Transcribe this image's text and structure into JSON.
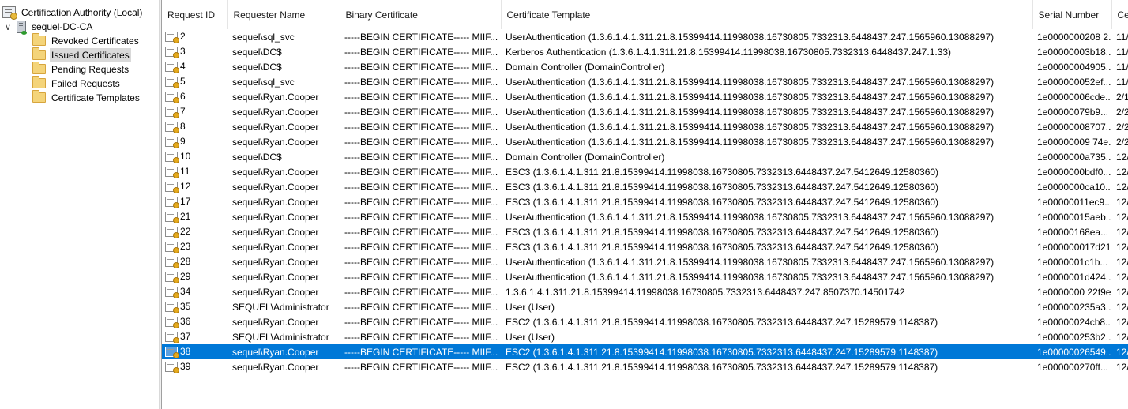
{
  "tree": {
    "root": "Certification Authority (Local)",
    "ca": "sequel-DC-CA",
    "children": [
      "Revoked Certificates",
      "Issued Certificates",
      "Pending Requests",
      "Failed Requests",
      "Certificate Templates"
    ],
    "selected_index": 1,
    "expand_glyph": "∨"
  },
  "table": {
    "headers": [
      "Request ID",
      "Requester Name",
      "Binary Certificate",
      "Certificate Template",
      "Serial Number",
      "Ce"
    ],
    "selected_row": 21,
    "rows": [
      [
        "2",
        "sequel\\sql_svc",
        "-----BEGIN CERTIFICATE-----  MIIF...",
        "UserAuthentication (1.3.6.1.4.1.311.21.8.15399414.11998038.16730805.7332313.6448437.247.1565960.13088297)",
        "1e0000000208 2...",
        "11/"
      ],
      [
        "3",
        "sequel\\DC$",
        "-----BEGIN CERTIFICATE-----  MIIF...",
        "Kerberos Authentication (1.3.6.1.4.1.311.21.8.15399414.11998038.16730805.7332313.6448437.247.1.33)",
        "1e00000003b18...",
        "11/"
      ],
      [
        "4",
        "sequel\\DC$",
        "-----BEGIN CERTIFICATE-----  MIIF...",
        "Domain Controller (DomainController)",
        "1e00000004905...",
        "11/"
      ],
      [
        "5",
        "sequel\\sql_svc",
        "-----BEGIN CERTIFICATE-----  MIIF...",
        "UserAuthentication (1.3.6.1.4.1.311.21.8.15399414.11998038.16730805.7332313.6448437.247.1565960.13088297)",
        "1e000000052ef...",
        "11/"
      ],
      [
        "6",
        "sequel\\Ryan.Cooper",
        "-----BEGIN CERTIFICATE-----  MIIF...",
        "UserAuthentication (1.3.6.1.4.1.311.21.8.15399414.11998038.16730805.7332313.6448437.247.1565960.13088297)",
        "1e00000006cde...",
        "2/1"
      ],
      [
        "7",
        "sequel\\Ryan.Cooper",
        "-----BEGIN CERTIFICATE-----  MIIF...",
        "UserAuthentication (1.3.6.1.4.1.311.21.8.15399414.11998038.16730805.7332313.6448437.247.1565960.13088297)",
        "1e00000079b9...",
        "2/2"
      ],
      [
        "8",
        "sequel\\Ryan.Cooper",
        "-----BEGIN CERTIFICATE-----  MIIF...",
        "UserAuthentication (1.3.6.1.4.1.311.21.8.15399414.11998038.16730805.7332313.6448437.247.1565960.13088297)",
        "1e00000008707...",
        "2/2"
      ],
      [
        "9",
        "sequel\\Ryan.Cooper",
        "-----BEGIN CERTIFICATE-----  MIIF...",
        "UserAuthentication (1.3.6.1.4.1.311.21.8.15399414.11998038.16730805.7332313.6448437.247.1565960.13088297)",
        "1e00000009 74e...",
        "2/2"
      ],
      [
        "10",
        "sequel\\DC$",
        "-----BEGIN CERTIFICATE-----  MIIF...",
        "Domain Controller (DomainController)",
        "1e0000000a735...",
        "12/"
      ],
      [
        "11",
        "sequel\\Ryan.Cooper",
        "-----BEGIN CERTIFICATE-----  MIIF...",
        "ESC3 (1.3.6.1.4.1.311.21.8.15399414.11998038.16730805.7332313.6448437.247.5412649.12580360)",
        "1e0000000bdf0...",
        "12/"
      ],
      [
        "12",
        "sequel\\Ryan.Cooper",
        "-----BEGIN CERTIFICATE-----  MIIF...",
        "ESC3 (1.3.6.1.4.1.311.21.8.15399414.11998038.16730805.7332313.6448437.247.5412649.12580360)",
        "1e0000000ca10...",
        "12/"
      ],
      [
        "17",
        "sequel\\Ryan.Cooper",
        "-----BEGIN CERTIFICATE-----  MIIF...",
        "ESC3 (1.3.6.1.4.1.311.21.8.15399414.11998038.16730805.7332313.6448437.247.5412649.12580360)",
        "1e00000011ec9...",
        "12/"
      ],
      [
        "21",
        "sequel\\Ryan.Cooper",
        "-----BEGIN CERTIFICATE-----  MIIF...",
        "UserAuthentication (1.3.6.1.4.1.311.21.8.15399414.11998038.16730805.7332313.6448437.247.1565960.13088297)",
        "1e00000015aeb...",
        "12/"
      ],
      [
        "22",
        "sequel\\Ryan.Cooper",
        "-----BEGIN CERTIFICATE-----  MIIF...",
        "ESC3 (1.3.6.1.4.1.311.21.8.15399414.11998038.16730805.7332313.6448437.247.5412649.12580360)",
        "1e00000168ea...",
        "12/"
      ],
      [
        "23",
        "sequel\\Ryan.Cooper",
        "-----BEGIN CERTIFICATE-----  MIIF...",
        "ESC3 (1.3.6.1.4.1.311.21.8.15399414.11998038.16730805.7332313.6448437.247.5412649.12580360)",
        "1e000000017d21...",
        "12/"
      ],
      [
        "28",
        "sequel\\Ryan.Cooper",
        "-----BEGIN CERTIFICATE-----  MIIF...",
        "UserAuthentication (1.3.6.1.4.1.311.21.8.15399414.11998038.16730805.7332313.6448437.247.1565960.13088297)",
        "1e0000001c1b...",
        "12/"
      ],
      [
        "29",
        "sequel\\Ryan.Cooper",
        "-----BEGIN CERTIFICATE-----  MIIF...",
        "UserAuthentication (1.3.6.1.4.1.311.21.8.15399414.11998038.16730805.7332313.6448437.247.1565960.13088297)",
        "1e0000001d424...",
        "12/"
      ],
      [
        "34",
        "sequel\\Ryan.Cooper",
        "-----BEGIN CERTIFICATE-----  MIIF...",
        "1.3.6.1.4.1.311.21.8.15399414.11998038.16730805.7332313.6448437.247.8507370.14501742",
        "1e0000000 22f9e...",
        "12/"
      ],
      [
        "35",
        "SEQUEL\\Administrator",
        "-----BEGIN CERTIFICATE-----  MIIF...",
        "User (User)",
        "1e000000235a3...",
        "12/"
      ],
      [
        "36",
        "sequel\\Ryan.Cooper",
        "-----BEGIN CERTIFICATE-----  MIIF...",
        "ESC2 (1.3.6.1.4.1.311.21.8.15399414.11998038.16730805.7332313.6448437.247.15289579.1148387)",
        "1e00000024cb8...",
        "12/"
      ],
      [
        "37",
        "SEQUEL\\Administrator",
        "-----BEGIN CERTIFICATE-----  MIIF...",
        "User (User)",
        "1e000000253b2...",
        "12/"
      ],
      [
        "38",
        "sequel\\Ryan.Cooper",
        "-----BEGIN CERTIFICATE-----  MIIF...",
        "ESC2 (1.3.6.1.4.1.311.21.8.15399414.11998038.16730805.7332313.6448437.247.15289579.1148387)",
        "1e00000026549...",
        "12/"
      ],
      [
        "39",
        "sequel\\Ryan.Cooper",
        "-----BEGIN CERTIFICATE-----  MIIF...",
        "ESC2 (1.3.6.1.4.1.311.21.8.15399414.11998038.16730805.7332313.6448437.247.15289579.1148387)",
        "1e000000270ff...",
        "12/"
      ]
    ]
  },
  "colors": {
    "selection": "#0078d7",
    "tree_selection": "#d9d9d9",
    "folder": "#f4d47a"
  },
  "icons": {
    "root": "certificate-authority-icon",
    "ca": "ca-server-icon",
    "folder": "folder-icon",
    "row": "certificate-icon"
  }
}
